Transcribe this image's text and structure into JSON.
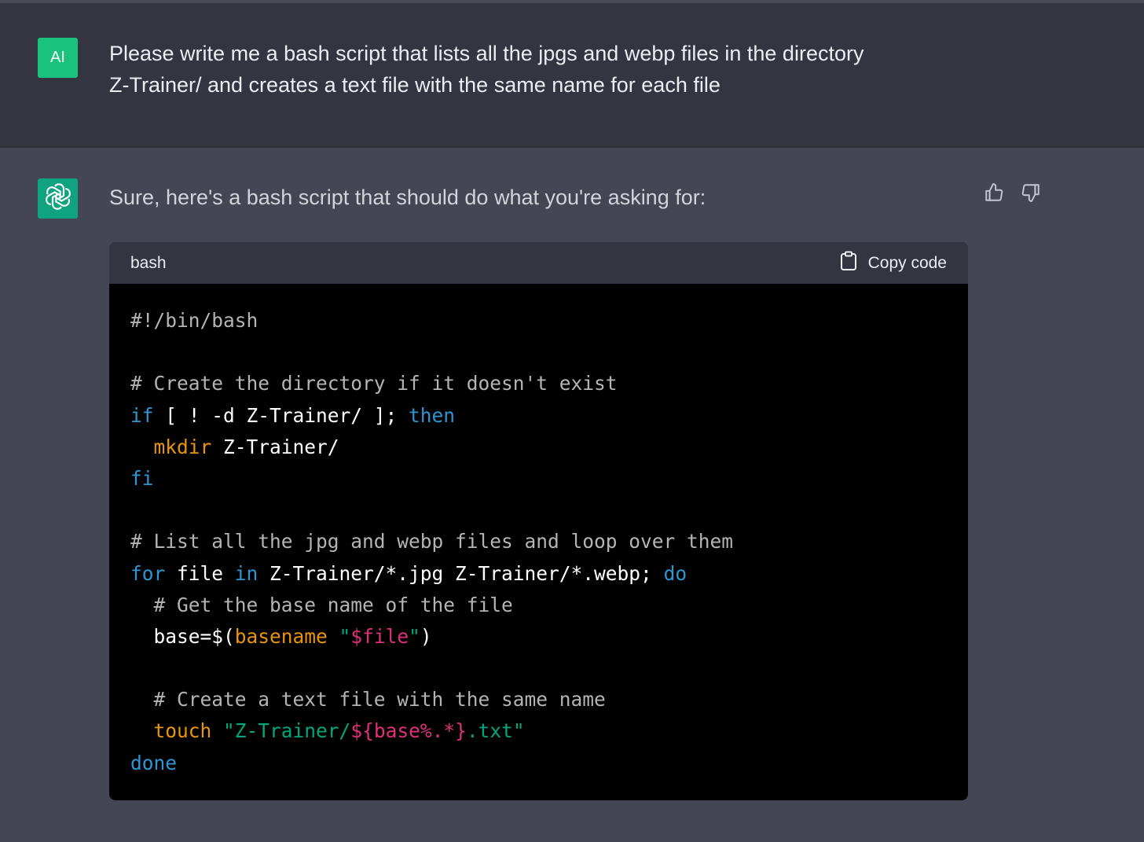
{
  "user": {
    "avatar_label": "AI",
    "message_line1": "Please write me a bash script that lists all the jpgs and webp files in the directory",
    "message_line2": "Z-Trainer/ and creates a text file with the same name for each file"
  },
  "assistant": {
    "intro": "Sure, here's a bash script that should do what you're asking for:",
    "code_block": {
      "language": "bash",
      "copy_label": "Copy code",
      "lines": [
        [
          {
            "t": "comment",
            "v": "#!/bin/bash"
          }
        ],
        [],
        [
          {
            "t": "comment",
            "v": "# Create the directory if it doesn't exist"
          }
        ],
        [
          {
            "t": "keyword",
            "v": "if"
          },
          {
            "t": "plain",
            "v": " [ ! -d Z-Trainer/ ]; "
          },
          {
            "t": "keyword",
            "v": "then"
          }
        ],
        [
          {
            "t": "plain",
            "v": "  "
          },
          {
            "t": "builtin",
            "v": "mkdir"
          },
          {
            "t": "plain",
            "v": " Z-Trainer/"
          }
        ],
        [
          {
            "t": "keyword",
            "v": "fi"
          }
        ],
        [],
        [
          {
            "t": "comment",
            "v": "# List all the jpg and webp files and loop over them"
          }
        ],
        [
          {
            "t": "keyword",
            "v": "for"
          },
          {
            "t": "plain",
            "v": " file "
          },
          {
            "t": "keyword",
            "v": "in"
          },
          {
            "t": "plain",
            "v": " Z-Trainer/*.jpg Z-Trainer/*.webp; "
          },
          {
            "t": "keyword",
            "v": "do"
          }
        ],
        [
          {
            "t": "plain",
            "v": "  "
          },
          {
            "t": "comment",
            "v": "# Get the base name of the file"
          }
        ],
        [
          {
            "t": "plain",
            "v": "  base=$("
          },
          {
            "t": "builtin",
            "v": "basename"
          },
          {
            "t": "plain",
            "v": " "
          },
          {
            "t": "string",
            "v": "\""
          },
          {
            "t": "var",
            "v": "$file"
          },
          {
            "t": "string",
            "v": "\""
          },
          {
            "t": "plain",
            "v": ")"
          }
        ],
        [],
        [
          {
            "t": "plain",
            "v": "  "
          },
          {
            "t": "comment",
            "v": "# Create a text file with the same name"
          }
        ],
        [
          {
            "t": "plain",
            "v": "  "
          },
          {
            "t": "builtin",
            "v": "touch"
          },
          {
            "t": "plain",
            "v": " "
          },
          {
            "t": "string",
            "v": "\"Z-Trainer/"
          },
          {
            "t": "var",
            "v": "${base%.*}"
          },
          {
            "t": "string",
            "v": ".txt\""
          }
        ],
        [
          {
            "t": "keyword",
            "v": "done"
          }
        ]
      ]
    },
    "icons": {
      "bot_avatar": "openai-logo-icon",
      "thumbs_up": "thumbs-up-icon",
      "thumbs_down": "thumbs-down-icon",
      "copy": "clipboard-icon"
    }
  },
  "colors": {
    "user_bg": "#343541",
    "assistant_bg": "#444654",
    "avatar_green": "#19c37d",
    "code_bg": "#000000",
    "comment": "#b4b4b4",
    "keyword": "#2e95d3",
    "builtin": "#e9950c",
    "string": "#00a67d",
    "variable": "#df3079"
  }
}
